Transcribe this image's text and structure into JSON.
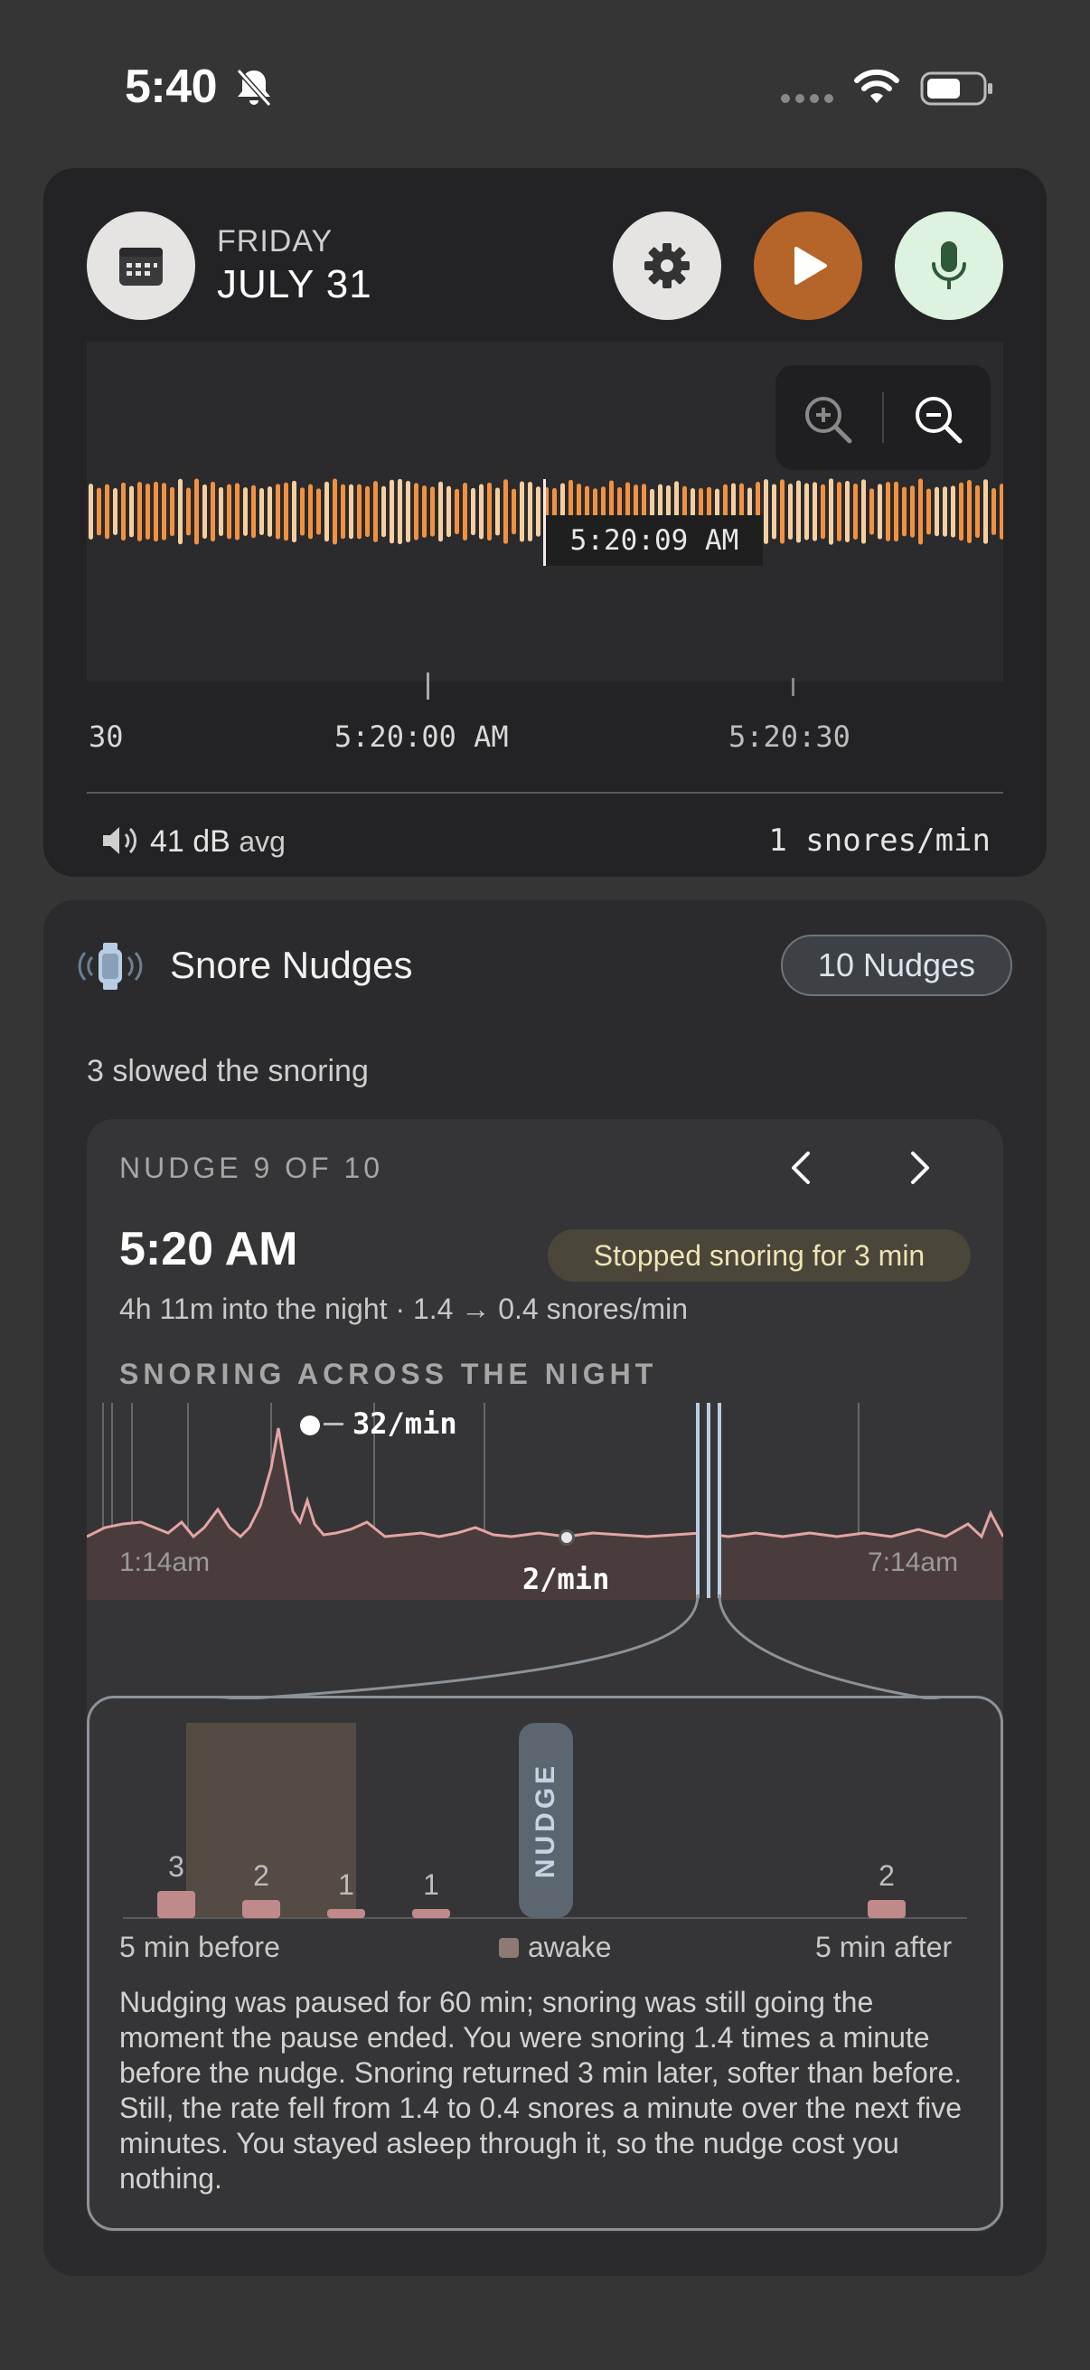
{
  "status_bar": {
    "time": "5:40",
    "icons": [
      "bell-slash-icon",
      "cellular-dots-icon",
      "wifi-icon",
      "battery-icon"
    ]
  },
  "recording": {
    "day": "FRIDAY",
    "date": "JULY 31",
    "buttons": {
      "calendar": "calendar-icon",
      "settings": "gear-icon",
      "play": "play-icon",
      "record": "microphone-icon",
      "zoom_in": "zoom-in-icon",
      "zoom_out": "zoom-out-icon"
    },
    "playhead_time": "5:20:09 AM",
    "timeline": {
      "left_label": "30",
      "center_label": "5:20:00 AM",
      "right_label": "5:20:30"
    },
    "volume": {
      "value": "41 dB",
      "suffix": "avg"
    },
    "snore_rate": "1 snores/min",
    "colors": {
      "wave_primary": "#f2913f",
      "wave_light": "#f6cfa0",
      "play_button": "#b5652a",
      "mic_button": "#ddf2df"
    }
  },
  "nudges": {
    "title": "Snore Nudges",
    "count_badge": "10 Nudges",
    "summary": "3 slowed the snoring",
    "pager": {
      "label": "NUDGE 9 OF 10",
      "prev": "chevron-left-icon",
      "next": "chevron-right-icon"
    },
    "nudge": {
      "time": "5:20 AM",
      "result_badge": "Stopped snoring for 3 min",
      "detail": "4h 11m into the night · 1.4 → 0.4 snores/min"
    },
    "night_chart": {
      "heading": "SNORING ACROSS THE NIGHT",
      "peak_label": "32/min",
      "low_label": "2/min",
      "start_label": "1:14am",
      "end_label": "7:14am"
    },
    "zoom_chart": {
      "nudge_label": "NUDGE",
      "before_label": "5 min before",
      "awake_label": "awake",
      "after_label": "5 min after",
      "description": "Nudging was paused for 60 min; snoring was still going the moment the pause ended. You were snoring 1.4 times a minute before the nudge. Snoring returned 3 min later, softer than before. Still, the rate fell from 1.4 to 0.4 snores a minute over the next five minutes. You stayed asleep through it, so the nudge cost you nothing."
    }
  },
  "chart_data": {
    "type": "bar",
    "categories": [
      "-5",
      "-4",
      "-3",
      "-2",
      "-1",
      "0",
      "1",
      "2",
      "3",
      "4"
    ],
    "values": [
      3,
      2,
      1,
      1,
      0,
      0,
      0,
      0,
      2,
      0
    ],
    "awake_minutes": [
      "-5",
      "-4"
    ],
    "title": "",
    "xlabel": "",
    "ylabel": ""
  }
}
